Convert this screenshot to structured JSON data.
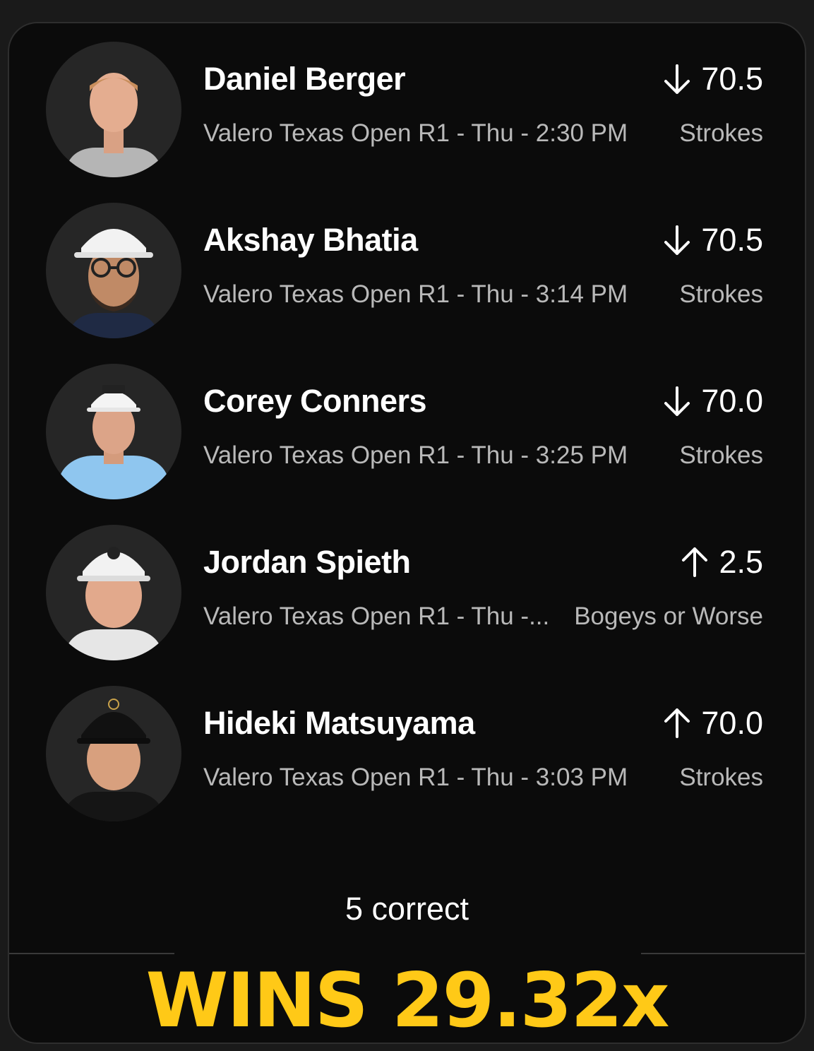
{
  "picks": [
    {
      "player": "Daniel Berger",
      "event": "Valero Texas Open R1  - Thu - 2:30 PM",
      "direction": "under",
      "direction_icon": "arrow-down-icon",
      "line": "70.5",
      "stat": "Strokes",
      "cap": "none",
      "shirt_color": "#b5b5b5"
    },
    {
      "player": "Akshay Bhatia",
      "event": "Valero Texas Open R1  - Thu - 3:14 PM",
      "direction": "under",
      "direction_icon": "arrow-down-icon",
      "line": "70.5",
      "stat": "Strokes",
      "cap": "white",
      "shirt_color": "#1f2a44"
    },
    {
      "player": "Corey Conners",
      "event": "Valero Texas Open R1  - Thu - 3:25 PM",
      "direction": "under",
      "direction_icon": "arrow-down-icon",
      "line": "70.0",
      "stat": "Strokes",
      "cap": "white",
      "shirt_color": "#8fc6ef"
    },
    {
      "player": "Jordan Spieth",
      "event": "Valero Texas Open R1  - Thu -...",
      "direction": "over",
      "direction_icon": "arrow-up-icon",
      "line": "2.5",
      "stat": "Bogeys or Worse",
      "cap": "white",
      "shirt_color": "#e6e6e6"
    },
    {
      "player": "Hideki Matsuyama",
      "event": "Valero Texas Open R1  - Thu - 3:03 PM",
      "direction": "over",
      "direction_icon": "arrow-up-icon",
      "line": "70.0",
      "stat": "Strokes",
      "cap": "black",
      "shirt_color": "#151515"
    }
  ],
  "summary": {
    "result": "5 correct",
    "payout": "WINS 29.32x"
  },
  "colors": {
    "accent": "#ffc917",
    "card_background": "#0b0b0b",
    "secondary_text": "#b9b9b9"
  }
}
